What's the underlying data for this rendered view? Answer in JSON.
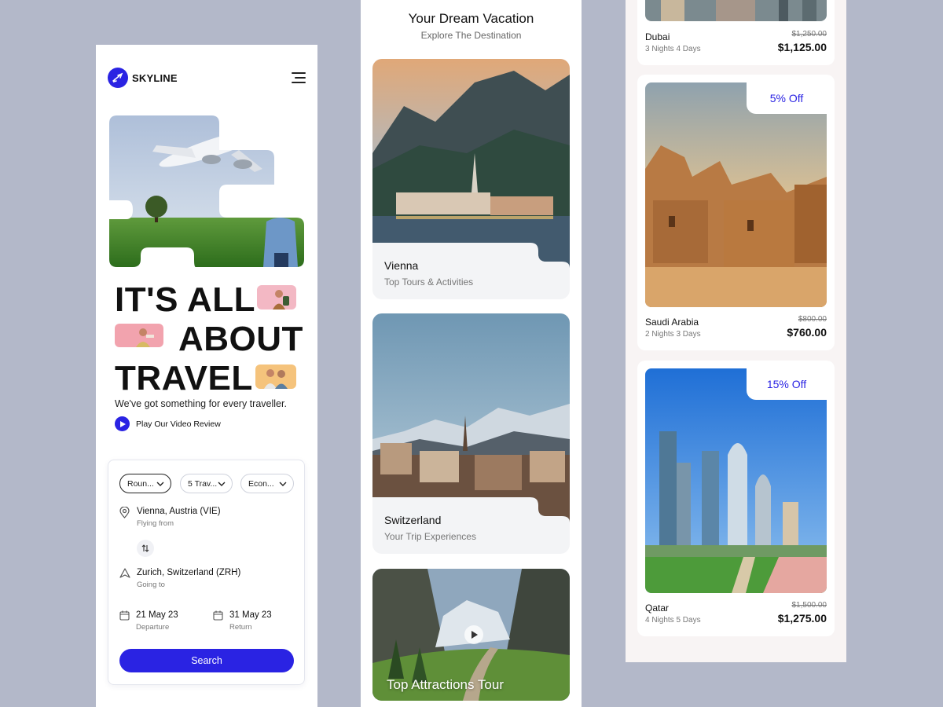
{
  "brand": {
    "name": "SKYLINE"
  },
  "hero": {
    "headline": [
      "IT'S ALL",
      "ABOUT",
      "TRAVEL"
    ],
    "tagline": "We've got something for every  traveller.",
    "video_label": "Play Our Video Review"
  },
  "booking": {
    "trip_type": "Roun...",
    "travellers": "5 Trav...",
    "cabin": "Econ...",
    "from_value": "Vienna, Austria (VIE)",
    "from_label": "Flying from",
    "to_value": "Zurich, Switzerland (ZRH)",
    "to_label": "Going to",
    "departure_date": "21 May 23",
    "departure_label": "Departure",
    "return_date": "31 May 23",
    "return_label": "Return",
    "search_label": "Search"
  },
  "destinations": {
    "title": "Your Dream Vacation",
    "subtitle": "Explore The Destination",
    "cards": [
      {
        "name": "Vienna",
        "desc": "Top Tours & Activities"
      },
      {
        "name": "Switzerland",
        "desc": "Your Trip Experiences"
      }
    ],
    "video_title": "Top Attractions Tour"
  },
  "packages": [
    {
      "name": "Dubai",
      "nights": "3 Nights 4 Days",
      "old_price": "$1,250.00",
      "price": "$1,125.00"
    },
    {
      "name": "Saudi Arabia",
      "nights": "2 Nights 3 Days",
      "old_price": "$800.00",
      "price": "$760.00",
      "discount": "5% Off"
    },
    {
      "name": "Qatar",
      "nights": "4 Nights 5 Days",
      "old_price": "$1,500.00",
      "price": "$1,275.00",
      "discount": "15% Off"
    }
  ],
  "colors": {
    "accent": "#2a23e3",
    "background": "#b3b8c9"
  },
  "icons": [
    "plane-icon",
    "menu-icon",
    "play-icon",
    "chevron-down-icon",
    "location-pin-icon",
    "swap-icon",
    "navigation-icon",
    "calendar-icon"
  ]
}
